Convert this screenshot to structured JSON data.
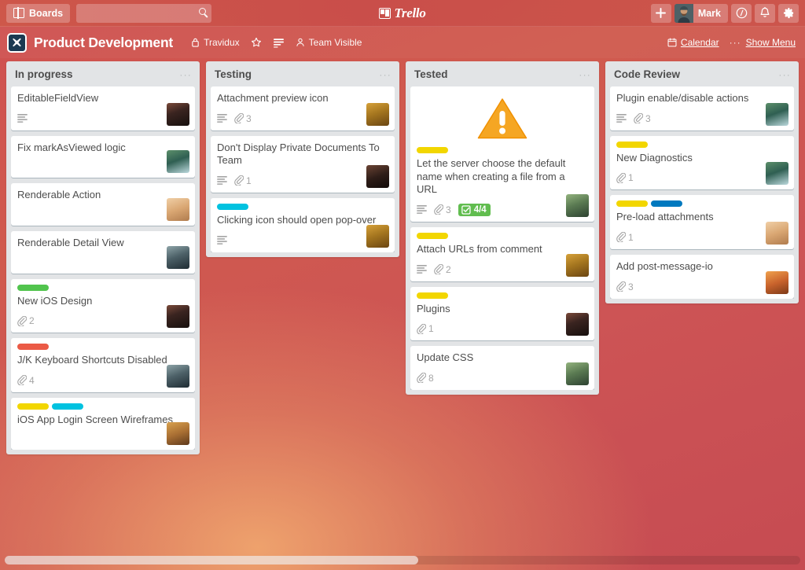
{
  "topbar": {
    "boards_label": "Boards",
    "boards_icon": "boards-icon",
    "search_placeholder": "",
    "search_value": "",
    "search_icon": "search-icon",
    "brand": "Trello",
    "add_label": "+",
    "user_name": "Mark",
    "info_label": "ⓘ",
    "notifications_label": "△",
    "settings_label": "⚙"
  },
  "board": {
    "title": "Product Development",
    "org": "Travidux",
    "org_icon": "organization-icon",
    "star_icon": "star-icon",
    "subscribe_icon": "list-icon",
    "visibility": "Team Visible",
    "visibility_icon": "team-icon",
    "calendar_label": "Calendar",
    "calendar_icon": "calendar-icon",
    "more_dots": "···",
    "show_menu_label": "Show Menu"
  },
  "colors": {
    "label_green": "#51c44d",
    "label_yellow": "#f2d600",
    "label_orange": "#eb5a46",
    "label_blue": "#00c2e0",
    "label_navy": "#0079bf",
    "badge_green": "#61bd4f",
    "list_bg": "#e2e4e6",
    "card_text": "#4d4d4d"
  },
  "list_menu_dots": "···",
  "lists": [
    {
      "name": "In progress",
      "cards": [
        {
          "title": "EditableFieldView",
          "labels": [],
          "description": true,
          "attachments": null,
          "checklist": null,
          "avatar": "av-woman-dark",
          "cover": null
        },
        {
          "title": "Fix markAsViewed logic",
          "labels": [],
          "description": false,
          "attachments": null,
          "checklist": null,
          "avatar": "av-man-teal",
          "cover": null
        },
        {
          "title": "Renderable Action",
          "labels": [],
          "description": false,
          "attachments": null,
          "checklist": null,
          "avatar": "av-woman-smiling",
          "cover": null
        },
        {
          "title": "Renderable Detail View",
          "labels": [],
          "description": false,
          "attachments": null,
          "checklist": null,
          "avatar": "av-man-beanie",
          "cover": null
        },
        {
          "title": "New iOS Design",
          "labels": [
            "#51c44d"
          ],
          "description": false,
          "attachments": "2",
          "checklist": null,
          "avatar": "av-woman-dark",
          "cover": null
        },
        {
          "title": "J/K Keyboard Shortcuts Disabled",
          "labels": [
            "#eb5a46"
          ],
          "description": false,
          "attachments": "4",
          "checklist": null,
          "avatar": "av-man-beanie",
          "cover": null
        },
        {
          "title": "iOS App Login Screen Wireframes",
          "labels": [
            "#f2d600",
            "#00c2e0"
          ],
          "description": false,
          "attachments": null,
          "checklist": null,
          "avatar": "av-woman-curly",
          "cover": null
        }
      ]
    },
    {
      "name": "Testing",
      "cards": [
        {
          "title": "Attachment preview icon",
          "labels": [],
          "description": true,
          "attachments": "3",
          "checklist": null,
          "avatar": "av-man-turban",
          "cover": null
        },
        {
          "title": "Don't Display Private Documents To Team",
          "labels": [],
          "description": true,
          "attachments": "1",
          "checklist": null,
          "avatar": "av-woman-dark2",
          "cover": null
        },
        {
          "title": "Clicking icon should open pop-over",
          "labels": [
            "#00c2e0"
          ],
          "description": true,
          "attachments": null,
          "checklist": null,
          "avatar": "av-man-turban",
          "cover": null
        }
      ]
    },
    {
      "name": "Tested",
      "cards": [
        {
          "title": "Let the server choose the default name when creating a file from a URL",
          "labels": [
            "#f2d600"
          ],
          "description": true,
          "attachments": "3",
          "checklist": "4/4",
          "avatar": "av-person-hat",
          "cover": "warning-triangle"
        },
        {
          "title": "Attach URLs from comment",
          "labels": [
            "#f2d600"
          ],
          "description": true,
          "attachments": "2",
          "checklist": null,
          "avatar": "av-man-turban",
          "cover": null
        },
        {
          "title": "Plugins",
          "labels": [
            "#f2d600"
          ],
          "description": false,
          "attachments": "1",
          "checklist": null,
          "avatar": "av-woman-dark",
          "cover": null
        },
        {
          "title": "Update CSS",
          "labels": [],
          "description": false,
          "attachments": "8",
          "checklist": null,
          "avatar": "av-person-hat",
          "cover": null
        }
      ]
    },
    {
      "name": "Code Review",
      "cards": [
        {
          "title": "Plugin enable/disable actions",
          "labels": [],
          "description": true,
          "attachments": "3",
          "checklist": null,
          "avatar": "av-man-teal",
          "cover": null
        },
        {
          "title": "New Diagnostics",
          "labels": [
            "#f2d600"
          ],
          "description": false,
          "attachments": "1",
          "checklist": null,
          "avatar": "av-man-teal",
          "cover": null
        },
        {
          "title": "Pre-load attachments",
          "labels": [
            "#f2d600",
            "#0079bf"
          ],
          "description": false,
          "attachments": "1",
          "checklist": null,
          "avatar": "av-woman-smiling",
          "cover": null
        },
        {
          "title": "Add post-message-io",
          "labels": [],
          "description": false,
          "attachments": "3",
          "checklist": null,
          "avatar": "av-woman-orange",
          "cover": null
        }
      ]
    }
  ],
  "scrollbar": {
    "thumb_percent": "52"
  }
}
